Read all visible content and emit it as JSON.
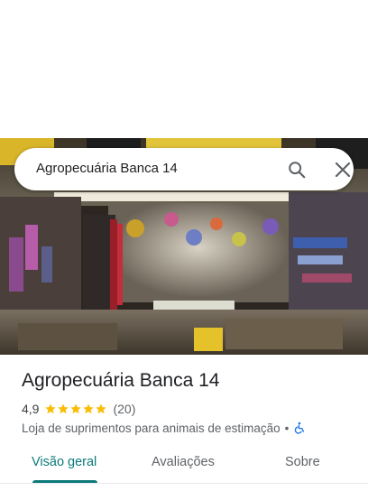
{
  "search": {
    "query": "Agropecuária Banca 14"
  },
  "place": {
    "name": "Agropecuária Banca 14",
    "rating": "4,9",
    "stars": 5,
    "review_count": "(20)",
    "category": "Loja de suprimentos para animais de estimação",
    "separator": "•"
  },
  "tabs": [
    {
      "label": "Visão geral",
      "active": true
    },
    {
      "label": "Avaliações",
      "active": false
    },
    {
      "label": "Sobre",
      "active": false
    }
  ],
  "colors": {
    "star": "#fbbc04",
    "active_tab": "#0b7a7a",
    "accessibility": "#1a73e8"
  },
  "icons": [
    "search-icon",
    "close-icon",
    "star-icon",
    "wheelchair-accessible-icon"
  ]
}
